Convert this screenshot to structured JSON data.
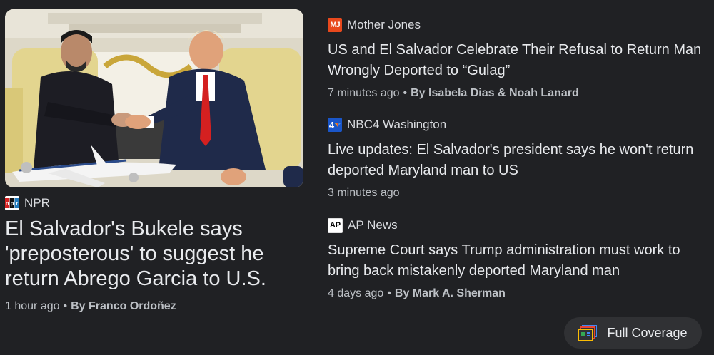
{
  "featured": {
    "image_alt": "Bukele and Trump shaking hands in the Oval Office",
    "source": {
      "name": "NPR",
      "logo_text": "NPR",
      "logo_color": "#d62021"
    },
    "title": "El Salvador's Bukele says 'preposterous' to suggest he return Abrego Garcia to U.S.",
    "time": "1 hour ago",
    "byline": "By Franco Ordoñez"
  },
  "stories": [
    {
      "source": {
        "name": "Mother Jones",
        "logo_text": "MJ",
        "logo_color": "#e8491d"
      },
      "headline": "US and El Salvador Celebrate Their Refusal to Return Man Wrongly Deported to “Gulag”",
      "time": "7 minutes ago",
      "byline": "By Isabela Dias & Noah Lanard"
    },
    {
      "source": {
        "name": "NBC4 Washington",
        "logo_text": "4",
        "logo_color": "#1a56c9"
      },
      "headline": "Live updates: El Salvador's president says he won't return deported Maryland man to US",
      "time": "3 minutes ago",
      "byline": ""
    },
    {
      "source": {
        "name": "AP News",
        "logo_text": "AP",
        "logo_color": "#ffffff"
      },
      "headline": "Supreme Court says Trump administration must work to bring back mistakenly deported Maryland man",
      "time": "4 days ago",
      "byline": "By Mark A. Sherman"
    }
  ],
  "full_coverage": {
    "label": "Full Coverage",
    "icon": "full-coverage-icon"
  },
  "separator": "•"
}
